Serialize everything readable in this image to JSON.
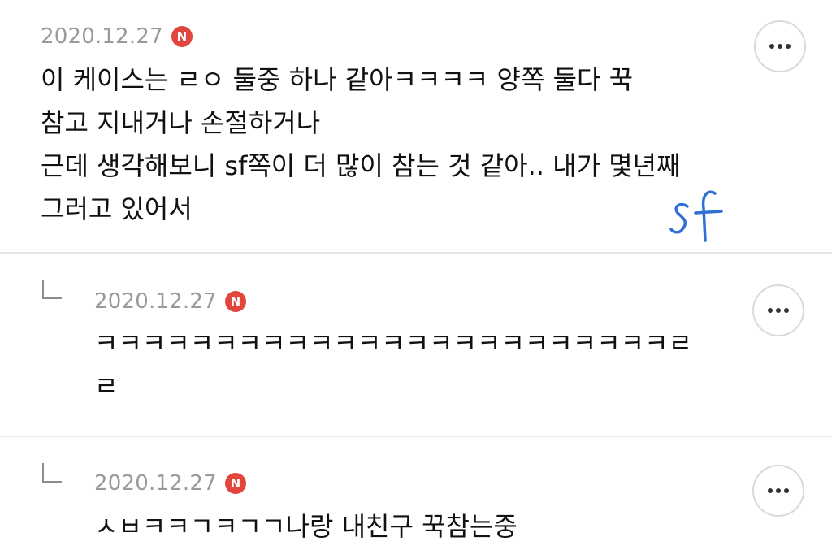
{
  "comments": [
    {
      "date": "2020.12.27",
      "badge": "N",
      "lines": [
        "이 케이스는 ㄹㅇ 둘중 하나 같아ㅋㅋㅋㅋ 양쪽 둘다 꾹",
        "참고 지내거나 손절하거나",
        "근데 생각해보니 sf쪽이 더 많이 참는 것 같아.. 내가 몇년째",
        "그러고 있어서"
      ],
      "handwriting": "sf"
    },
    {
      "date": "2020.12.27",
      "badge": "N",
      "lines": [
        "ㅋㅋㅋㅋㅋㅋㅋㅋㅋㅋㅋㅋㅋㅋㅋㅋㅋㅋㅋㅋㅋㅋㅋㅋㄹ",
        "ㄹ"
      ]
    },
    {
      "date": "2020.12.27",
      "badge": "N",
      "lines": [
        "ㅅㅂㅋㅋㄱㅋㄱㄱ나랑 내친구 꾹참는중"
      ]
    }
  ],
  "colors": {
    "badge": "#e0463c",
    "date": "#9a9a9a",
    "handwriting": "#2f6fd6",
    "divider": "#e6e6e6"
  },
  "icons": {
    "more": "more-horizontal-icon",
    "reply": "reply-arrow-icon"
  }
}
